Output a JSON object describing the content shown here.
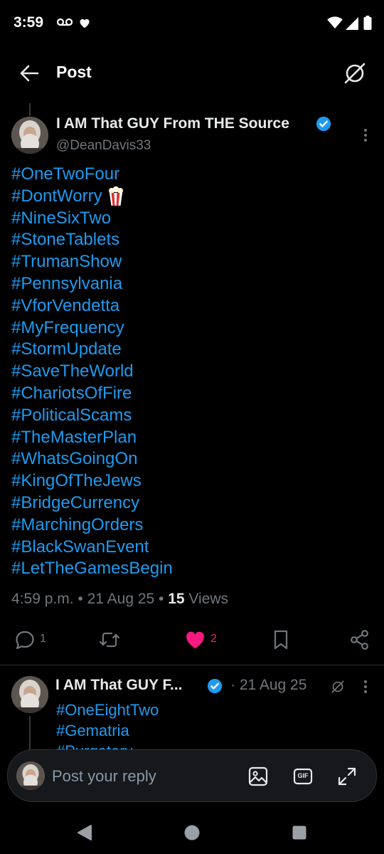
{
  "status_bar": {
    "time": "3:59",
    "icons": [
      "voicemail-icon",
      "heart-icon",
      "wifi-icon",
      "signal-icon",
      "battery-icon"
    ]
  },
  "header": {
    "title": "Post",
    "back_icon": "arrow-left-icon",
    "grok_icon": "grok-icon"
  },
  "post": {
    "author_name": "I AM That GUY From THE Source",
    "handle": "@DeanDavis33",
    "verified": true,
    "hashtags": [
      "#OneTwoFour",
      "#DontWorry",
      "#NineSixTwo",
      "#StoneTablets",
      "#TrumanShow",
      "#Pennsylvania",
      "#VforVendetta",
      "#MyFrequency",
      "#StormUpdate",
      "#SaveTheWorld",
      "#ChariotsOfFire",
      "#PoliticalScams",
      "#TheMasterPlan",
      "#WhatsGoingOn",
      "#KingOfTheJews",
      "#BridgeCurrency",
      "#MarchingOrders",
      "#BlackSwanEvent",
      "#LetTheGamesBegin"
    ],
    "emoji_after_index": 1,
    "emoji_icon": "popcorn-icon",
    "time": "4:59 p.m.",
    "date": "21 Aug 25",
    "views_count": "15",
    "views_label": "Views",
    "actions": {
      "replies": "1",
      "reposts": "",
      "likes": "2",
      "liked": true
    }
  },
  "reply": {
    "author_name": "I AM That GUY F...",
    "verified": true,
    "date": "· 21 Aug 25",
    "hashtags": [
      "#OneEightTwo",
      "#Gematria",
      "#Purgatory"
    ]
  },
  "composer": {
    "placeholder": "Post your reply",
    "gif_label": "GIF"
  },
  "colors": {
    "background": "#000000",
    "link": "#1d9bf0",
    "like": "#f91880",
    "secondary_text": "#71767b",
    "verified": "#1d9bf0"
  }
}
